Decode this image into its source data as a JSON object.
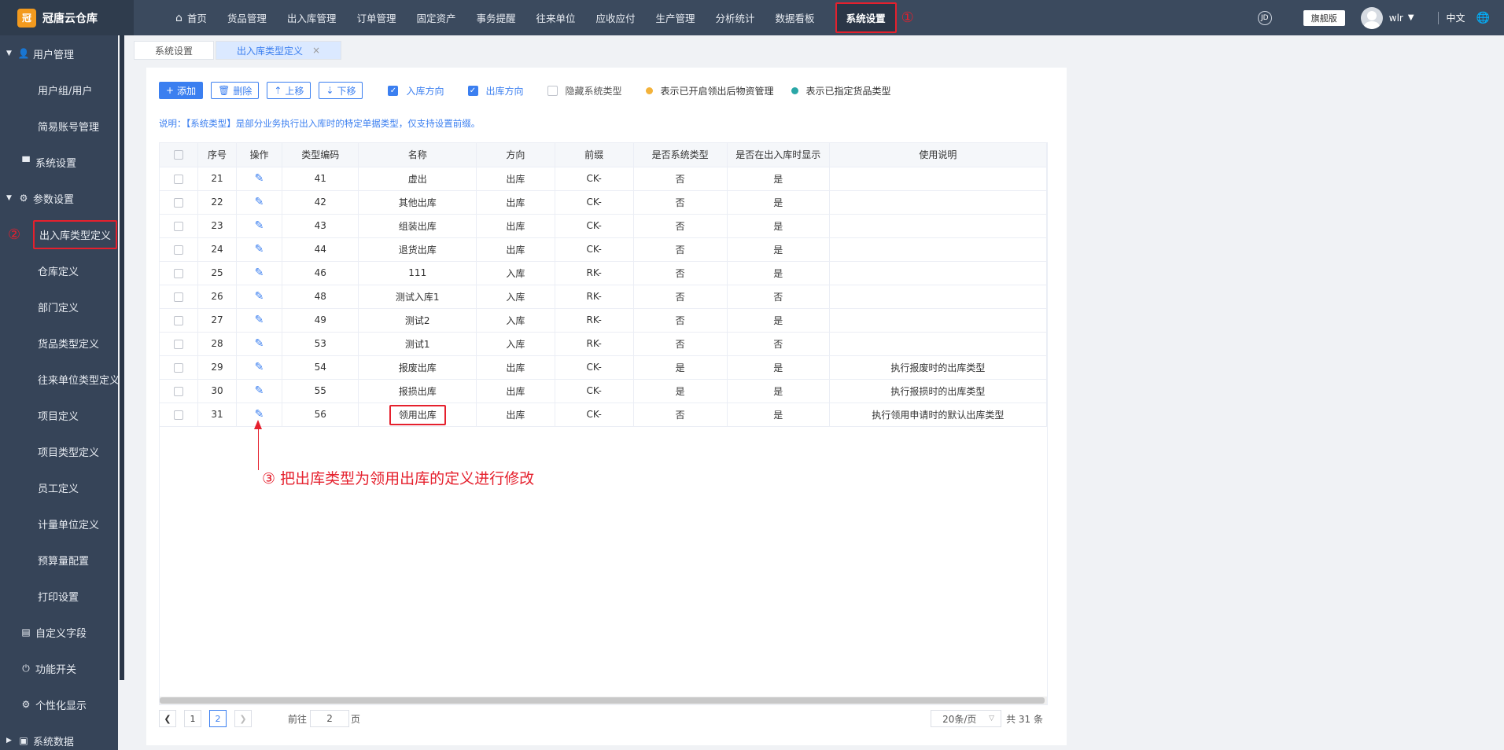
{
  "app": {
    "logo_mark": "冠",
    "name": "冠唐云仓库"
  },
  "nav": {
    "items": [
      "首页",
      "货品管理",
      "出入库管理",
      "订单管理",
      "固定资产",
      "事务提醒",
      "往来单位",
      "应收应付",
      "生产管理",
      "分析统计",
      "数据看板"
    ],
    "active": "系统设置",
    "active_mark": "①",
    "edition": "旗舰版",
    "user": "wlr",
    "language": "中文",
    "circle_icon_text": "JD"
  },
  "sidebar": {
    "user_mgmt": "用户管理",
    "user_group": "用户组/用户",
    "simple_account": "简易账号管理",
    "system_settings": "系统设置",
    "param_settings": "参数设置",
    "io_type_def": "出入库类型定义",
    "io_mark": "②",
    "subs": [
      "仓库定义",
      "部门定义",
      "货品类型定义",
      "往来单位类型定义",
      "项目定义",
      "项目类型定义",
      "员工定义",
      "计量单位定义",
      "预算量配置",
      "打印设置"
    ],
    "custom_fields": "自定义字段",
    "feature_switch": "功能开关",
    "personalize": "个性化显示",
    "system_data": "系统数据"
  },
  "tabs": {
    "tab1": "系统设置",
    "tab2": "出入库类型定义"
  },
  "toolbar": {
    "add": "添加",
    "delete": "删除",
    "move_up": "上移",
    "move_down": "下移",
    "in_dir": "入库方向",
    "out_dir": "出库方向",
    "hide_sys": "隐藏系统类型",
    "legend1": "表示已开启领出后物资管理",
    "legend2": "表示已指定货品类型",
    "legend1_color": "#f3b23a",
    "legend2_color": "#2aa7a7"
  },
  "note": "说明：【系统类型】是部分业务执行出入库时的特定单据类型，仅支持设置前缀。",
  "table": {
    "headers": [
      "序号",
      "操作",
      "类型编码",
      "名称",
      "方向",
      "前缀",
      "是否系统类型",
      "是否在出入库时显示",
      "使用说明"
    ],
    "rows": [
      [
        "21",
        "41",
        "虚出",
        "出库",
        "CK-",
        "否",
        "是",
        ""
      ],
      [
        "22",
        "42",
        "其他出库",
        "出库",
        "CK-",
        "否",
        "是",
        ""
      ],
      [
        "23",
        "43",
        "组装出库",
        "出库",
        "CK-",
        "否",
        "是",
        ""
      ],
      [
        "24",
        "44",
        "退货出库",
        "出库",
        "CK-",
        "否",
        "是",
        ""
      ],
      [
        "25",
        "46",
        "111",
        "入库",
        "RK-",
        "否",
        "是",
        ""
      ],
      [
        "26",
        "48",
        "测试入库1",
        "入库",
        "RK-",
        "否",
        "否",
        ""
      ],
      [
        "27",
        "49",
        "测试2",
        "入库",
        "RK-",
        "否",
        "是",
        ""
      ],
      [
        "28",
        "53",
        "测试1",
        "入库",
        "RK-",
        "否",
        "否",
        ""
      ],
      [
        "29",
        "54",
        "报废出库",
        "出库",
        "CK-",
        "是",
        "是",
        "执行报废时的出库类型"
      ],
      [
        "30",
        "55",
        "报损出库",
        "出库",
        "CK-",
        "是",
        "是",
        "执行报损时的出库类型"
      ],
      [
        "31",
        "56",
        "领用出库",
        "出库",
        "CK-",
        "否",
        "是",
        "执行领用申请时的默认出库类型"
      ]
    ]
  },
  "annotation": "③ 把出库类型为领用出库的定义进行修改",
  "pager": {
    "pages": [
      "1",
      "2"
    ],
    "current": "2",
    "goto_label": "前往",
    "goto_value": "2",
    "goto_suffix": "页",
    "page_size": "20条/页",
    "total": "共 31 条"
  }
}
